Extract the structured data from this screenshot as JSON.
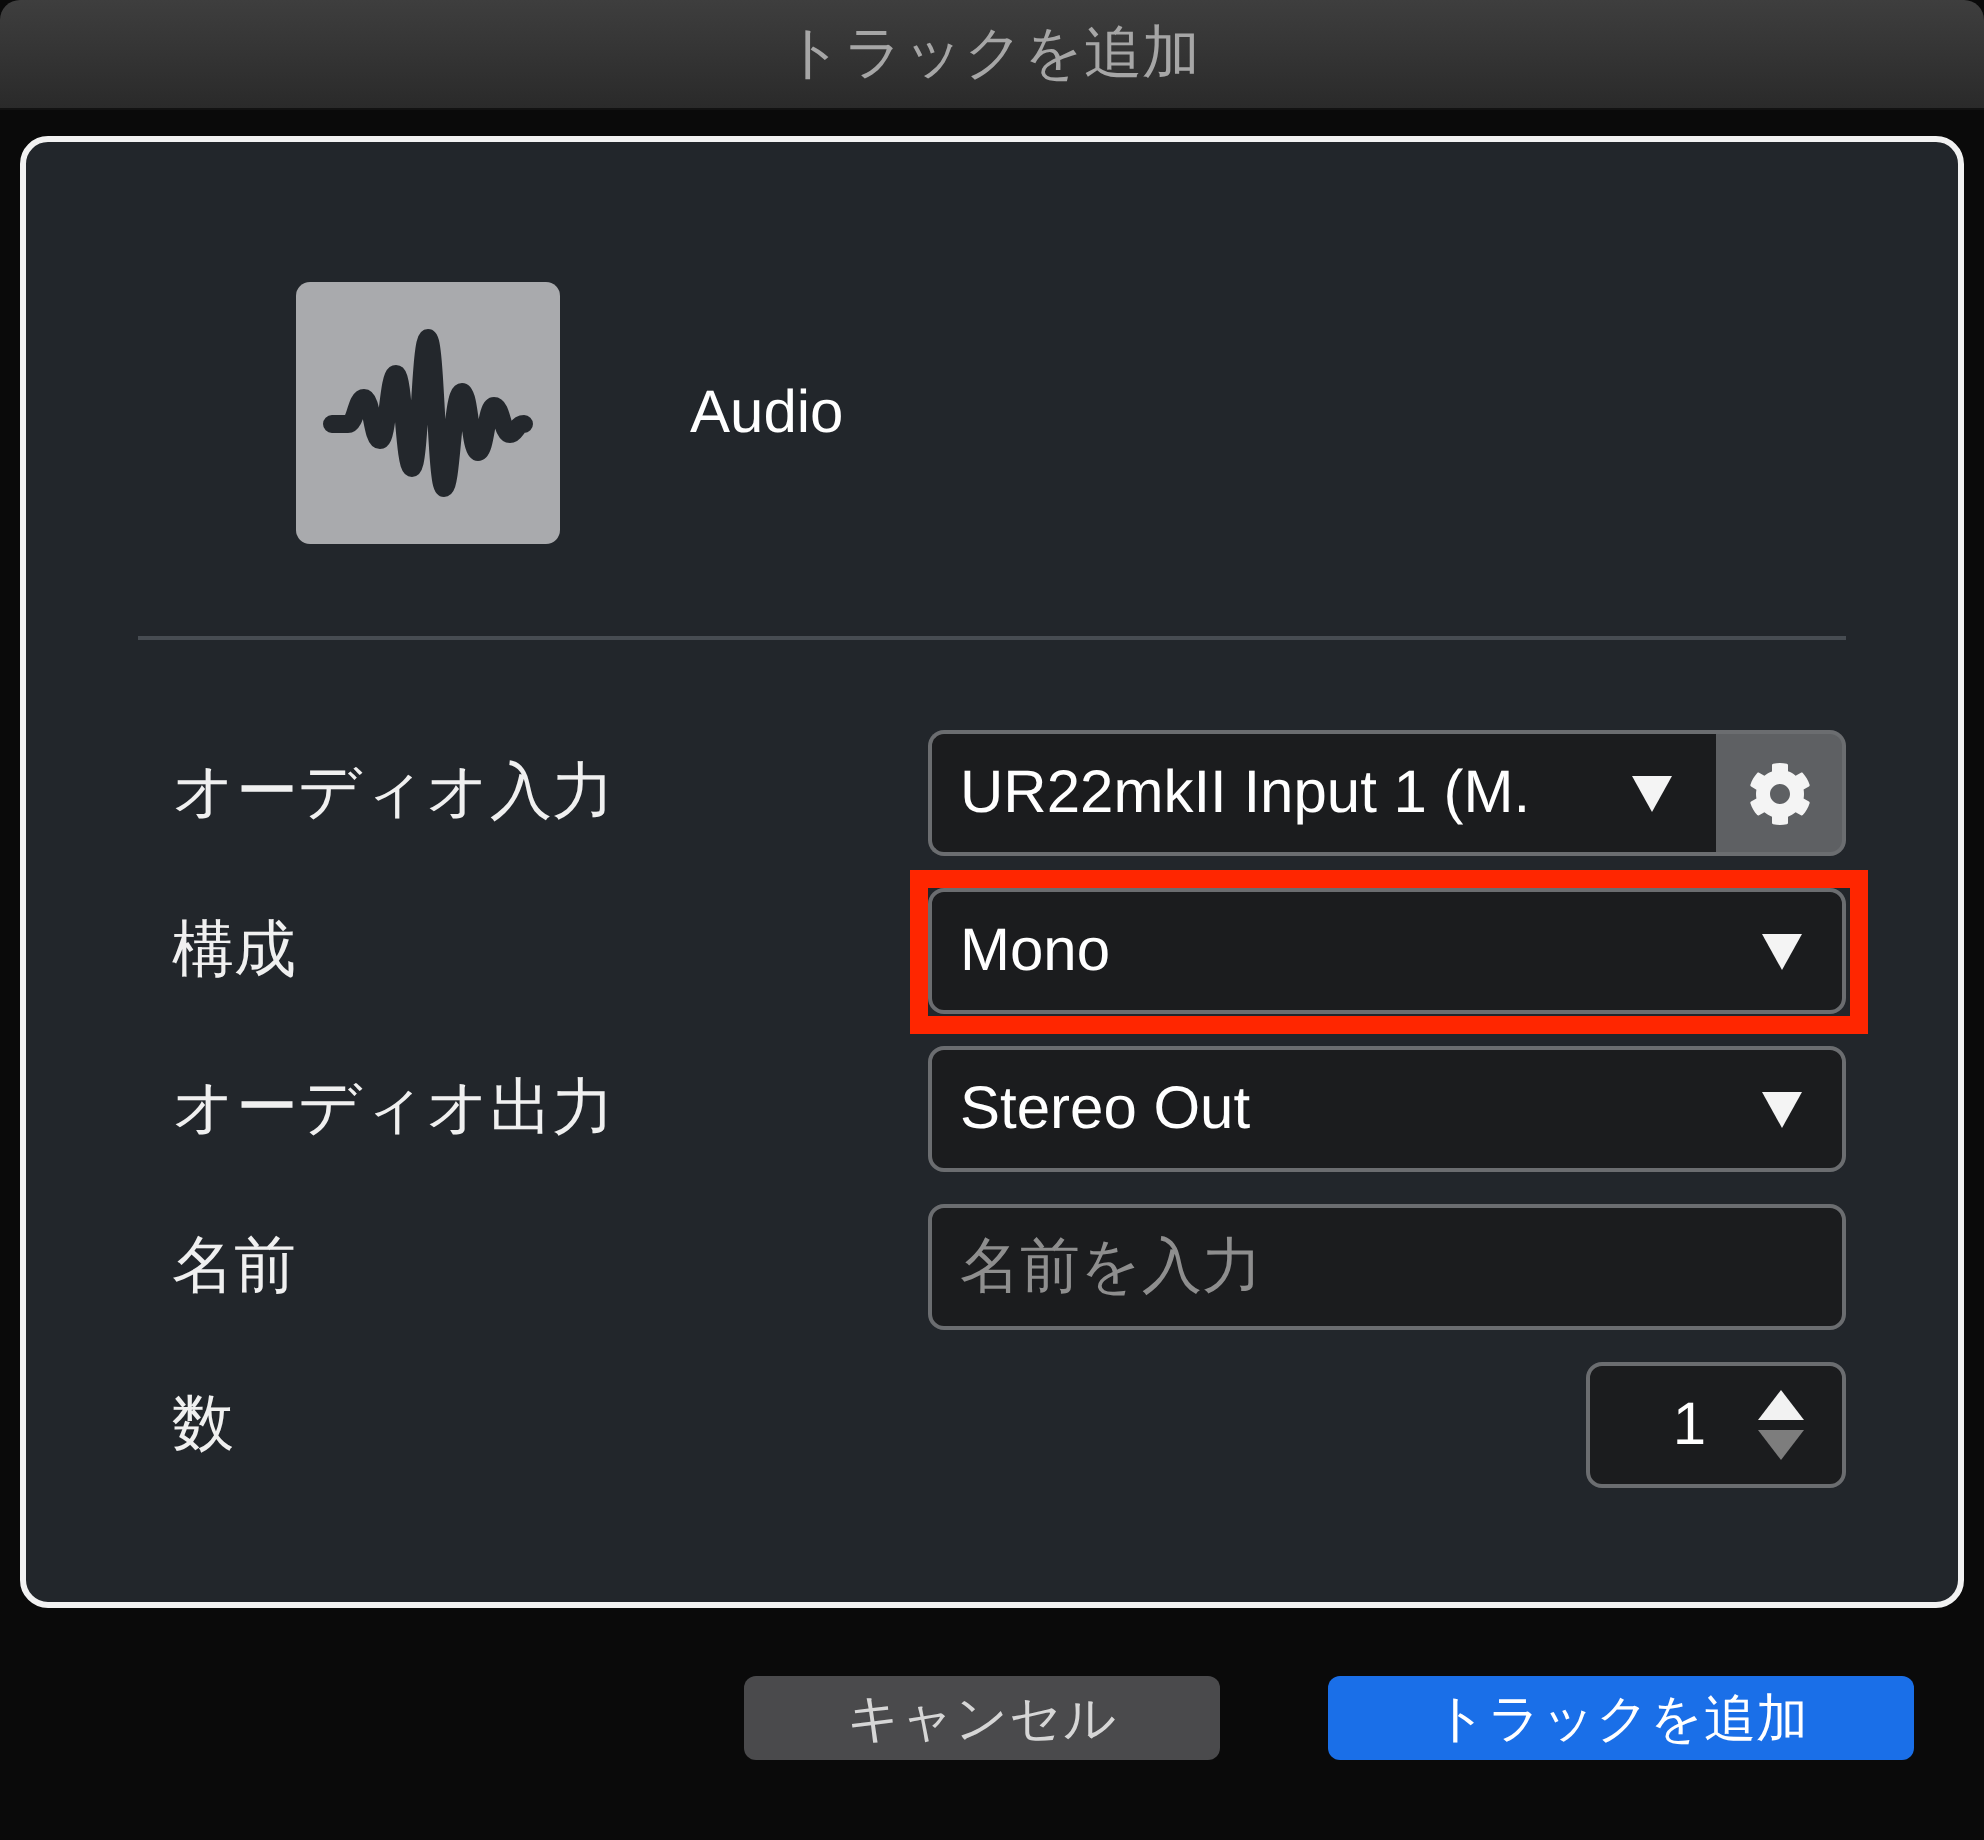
{
  "window": {
    "title": "トラックを追加"
  },
  "track_type": {
    "label": "Audio"
  },
  "fields": [
    {
      "kind": "select",
      "label": "オーディオ入力",
      "value": "UR22mkII Input 1 (M.",
      "settings_button": true,
      "highlighted": false
    },
    {
      "kind": "select",
      "label": "構成",
      "value": "Mono",
      "settings_button": false,
      "highlighted": true
    },
    {
      "kind": "select",
      "label": "オーディオ出力",
      "value": "Stereo Out",
      "settings_button": false,
      "highlighted": false
    },
    {
      "kind": "text",
      "label": "名前",
      "placeholder": "名前を入力",
      "highlighted": false
    },
    {
      "kind": "number",
      "label": "数",
      "value": "1",
      "decrement_disabled": true,
      "highlighted": false
    }
  ],
  "buttons": [
    {
      "kind": "secondary",
      "label": "キャンセル"
    },
    {
      "kind": "primary",
      "label": "トラックを追加"
    }
  ]
}
